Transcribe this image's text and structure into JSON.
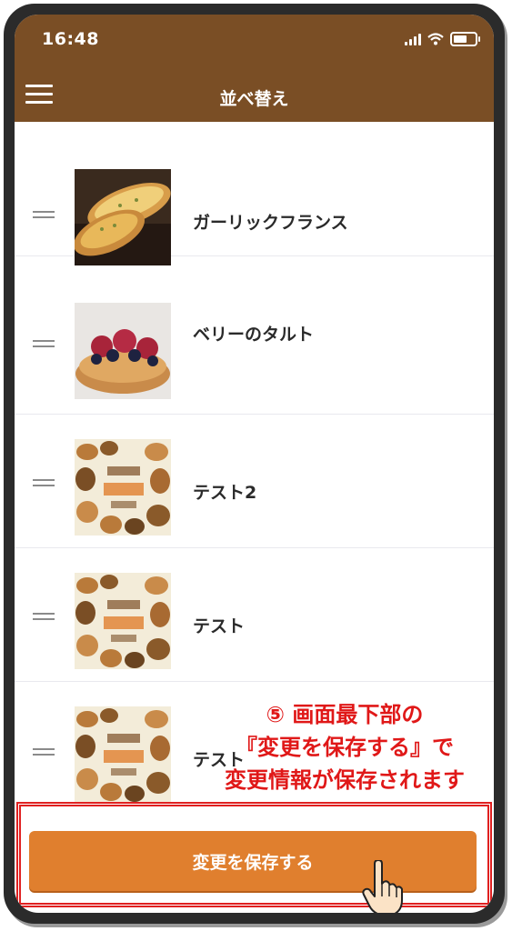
{
  "status_bar": {
    "time": "16:48"
  },
  "header": {
    "title": "並べ替え",
    "menu_icon": "hamburger-menu-icon",
    "background": "#7a4e25"
  },
  "items": [
    {
      "label": "ガーリックフランス",
      "image": "garlic-bread-photo"
    },
    {
      "label": "ベリーのタルト",
      "image": "berry-tart-photo"
    },
    {
      "label": "テスト2",
      "image": "bread-poster-photo"
    },
    {
      "label": "テスト",
      "image": "bread-poster-photo"
    },
    {
      "label": "テスト",
      "image": "bread-poster-photo"
    }
  ],
  "save_button": {
    "label": "変更を保存する",
    "color": "#e07f2e"
  },
  "annotation": {
    "line1": "⑤ 画面最下部の",
    "line2": "『変更を保存する』で",
    "line3": "変更情報が保存されます",
    "color": "#e01818"
  }
}
